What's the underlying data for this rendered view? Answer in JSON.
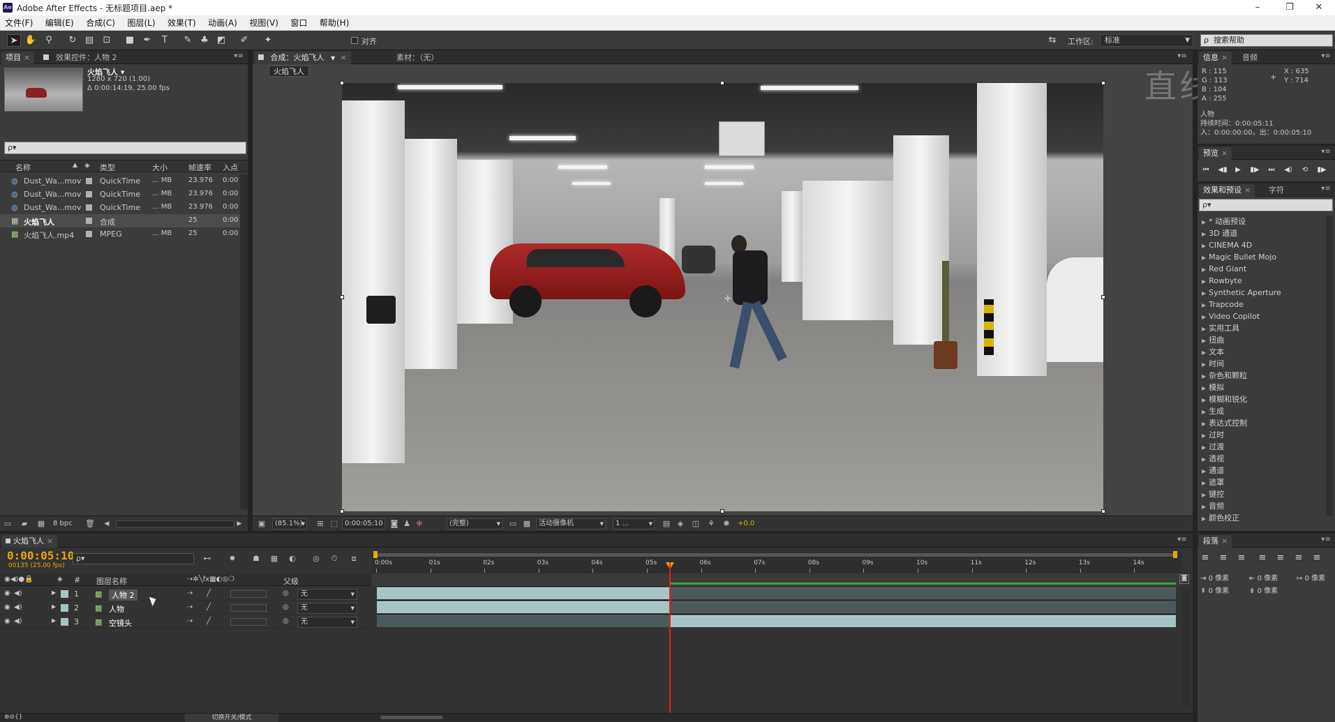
{
  "app": {
    "title": "Adobe After Effects - 无标题项目.aep *",
    "logo_text": "Ae",
    "window_controls": [
      "–",
      "❐",
      "✕"
    ]
  },
  "menu": [
    "文件(F)",
    "编辑(E)",
    "合成(C)",
    "图层(L)",
    "效果(T)",
    "动画(A)",
    "视图(V)",
    "窗口",
    "帮助(H)"
  ],
  "toolbar": {
    "snap_label": "对齐",
    "workspace_label": "工作区:",
    "workspace_value": "标准",
    "search_placeholder": "搜索帮助"
  },
  "project_panel": {
    "tab_project": "项目",
    "tab_effects": "效果控件：人物 2",
    "selected_name": "火焰飞人 ▾",
    "selected_info1": "1280 x 720 (1.00)",
    "selected_info2": "Δ 0:00:14:19, 25.00 fps",
    "search_placeholder": "ρ▾",
    "columns": [
      "名称",
      "类型",
      "大小",
      "帧速率",
      "入点"
    ],
    "items": [
      {
        "name": "Dust_Wa...mov",
        "type": "QuickTime",
        "size": "... MB",
        "fps": "23.976",
        "in": "0:00",
        "label_color": "#b0b0b0"
      },
      {
        "name": "Dust_Wa...mov",
        "type": "QuickTime",
        "size": "... MB",
        "fps": "23.976",
        "in": "0:00",
        "label_color": "#b0b0b0"
      },
      {
        "name": "Dust_Wa...mov",
        "type": "QuickTime",
        "size": "... MB",
        "fps": "23.976",
        "in": "0:00",
        "label_color": "#b0b0b0"
      },
      {
        "name": "火焰飞人",
        "type": "合成",
        "size": "",
        "fps": "25",
        "in": "0:00",
        "label_color": "#b0b0b0"
      },
      {
        "name": "火焰飞人.mp4",
        "type": "MPEG",
        "size": "... MB",
        "fps": "25",
        "in": "0:00",
        "label_color": "#b0b0b0"
      }
    ],
    "bpc": "8 bpc"
  },
  "comp_viewer": {
    "tab_comp": "合成：火焰飞人",
    "tab_footage": "素材：（无）",
    "comp_chip": "火焰飞人",
    "watermark": "直线网",
    "zoom": "(85.1%)",
    "timecode": "0:00:05:10",
    "quality": "(完整)",
    "camera": "活动摄像机",
    "views": "1 ...",
    "exposure": "+0.0"
  },
  "info_panel": {
    "tab_info": "信息",
    "tab_audio": "音频",
    "r": "R : 115",
    "g": "G : 113",
    "b": "B : 104",
    "a": "A : 255",
    "x": "X : 635",
    "y": "Y : 714",
    "layer_name": "人物",
    "duration": "持续时间：0:00:05:11",
    "in_out": "入：0:00:00:00，出：0:00:05:10"
  },
  "preview_panel": {
    "tab": "预览"
  },
  "effects_panel": {
    "tab_effects": "效果和预设",
    "tab_char": "字符",
    "search_placeholder": "ρ▾",
    "items": [
      "* 动画预设",
      "3D 通道",
      "CINEMA 4D",
      "Magic Bullet Mojo",
      "Red Giant",
      "Rowbyte",
      "Synthetic Aperture",
      "Trapcode",
      "Video Copilot",
      "实用工具",
      "扭曲",
      "文本",
      "时间",
      "杂色和颗粒",
      "模拟",
      "模糊和锐化",
      "生成",
      "表达式控制",
      "过时",
      "过渡",
      "透视",
      "通道",
      "遮罩",
      "键控",
      "音频",
      "颜色校正"
    ]
  },
  "paragraph_panel": {
    "tab": "段落",
    "v1": "0 像素",
    "v2": "0 像素",
    "v3": "0 像素",
    "v4": "0 像素",
    "v5": "0 像素"
  },
  "timeline": {
    "tab": "火焰飞人",
    "timecode": "0:00:05:10",
    "frame_info": "00135 (25.00 fps)",
    "search_placeholder": "ρ▾",
    "col_num": "#",
    "col_name": "图层名称",
    "col_parent": "父级",
    "ruler": [
      "0:00s",
      "01s",
      "02s",
      "03s",
      "04s",
      "05s",
      "06s",
      "07s",
      "08s",
      "09s",
      "10s",
      "11s",
      "12s",
      "13s",
      "14s"
    ],
    "layers": [
      {
        "num": "1",
        "name": "人物 2",
        "parent": "无"
      },
      {
        "num": "2",
        "name": "人物",
        "parent": "无"
      },
      {
        "num": "3",
        "name": "空镜头",
        "parent": "无"
      }
    ],
    "footer_toggle": "切换开关/模式"
  },
  "colors": {
    "accent_timecode": "#e8a800",
    "playhead": "#e02020",
    "layer_bar": "#a6c4c6",
    "work_area_green": "#3aa63a"
  }
}
